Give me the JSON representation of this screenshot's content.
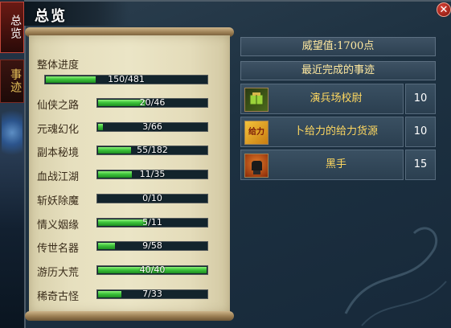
{
  "sidebar": {
    "tab_overview": "总览",
    "tab_events": "事迹"
  },
  "window": {
    "title": "总览",
    "close_label": "✕"
  },
  "progress": {
    "overall": {
      "label": "整体进度",
      "current": 150,
      "total": 481,
      "text": "150/481"
    },
    "categories": [
      {
        "label": "仙侠之路",
        "current": 20,
        "total": 46,
        "text": "20/46"
      },
      {
        "label": "元魂幻化",
        "current": 3,
        "total": 66,
        "text": "3/66"
      },
      {
        "label": "副本秘境",
        "current": 55,
        "total": 182,
        "text": "55/182"
      },
      {
        "label": "血战江湖",
        "current": 11,
        "total": 35,
        "text": "11/35"
      },
      {
        "label": "斩妖除魔",
        "current": 0,
        "total": 10,
        "text": "0/10"
      },
      {
        "label": "情义姻缘",
        "current": 5,
        "total": 11,
        "text": "5/11"
      },
      {
        "label": "传世名器",
        "current": 9,
        "total": 58,
        "text": "9/58"
      },
      {
        "label": "游历大荒",
        "current": 40,
        "total": 40,
        "text": "40/40"
      },
      {
        "label": "稀奇古怪",
        "current": 7,
        "total": 33,
        "text": "7/33"
      }
    ]
  },
  "prestige": {
    "text": "威望值:1700点"
  },
  "recent": {
    "header": "最近完成的事迹",
    "items": [
      {
        "name": "演兵场校尉",
        "points": "10",
        "icon": "green-book-icon"
      },
      {
        "name": "卜给力的给力货源",
        "points": "10",
        "icon": "gold-token-icon",
        "icon_text": "给力"
      },
      {
        "name": "黑手",
        "points": "15",
        "icon": "black-fist-icon"
      }
    ]
  }
}
